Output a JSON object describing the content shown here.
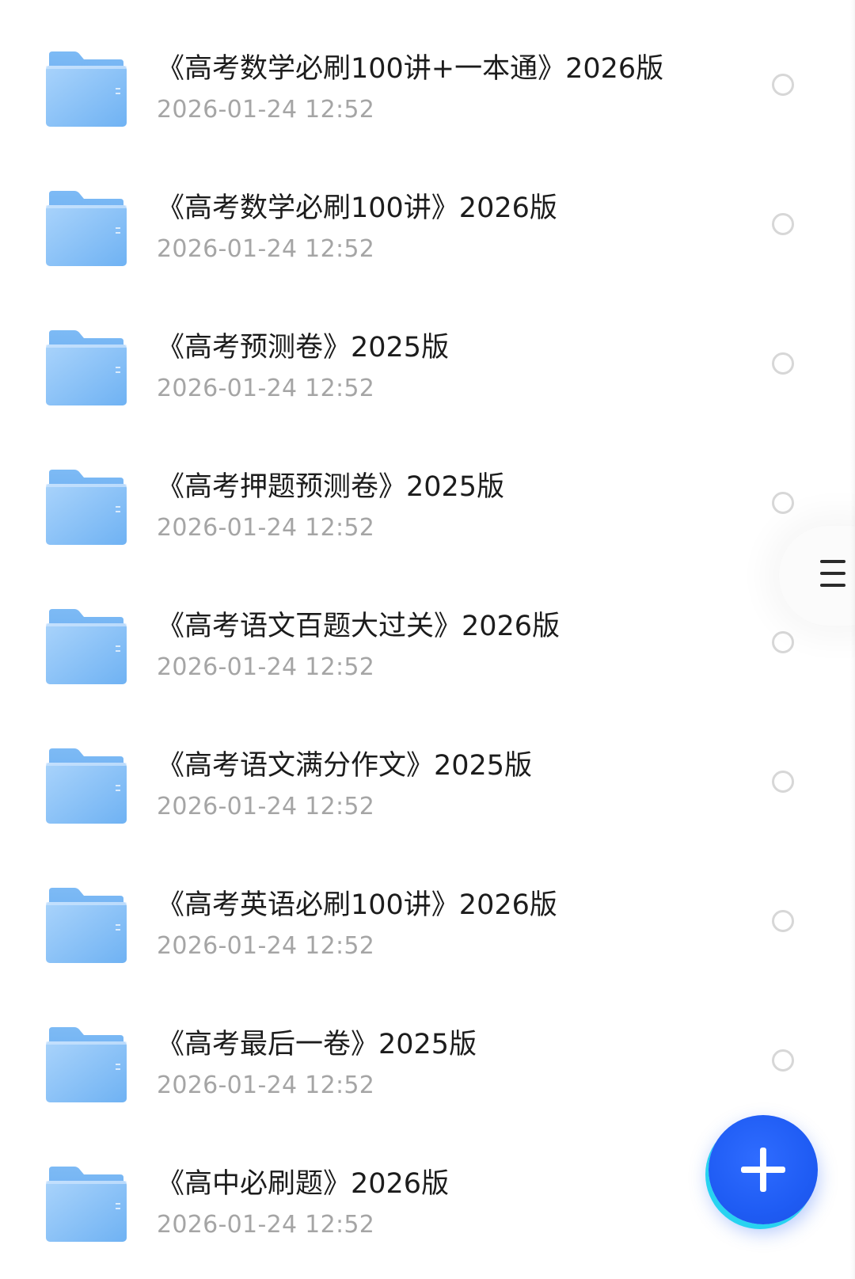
{
  "files": [
    {
      "name": "《高考数学必刷100讲+一本通》2026版",
      "modified": "2026-01-24 12:52",
      "icon": "folder-icon",
      "selected": false
    },
    {
      "name": "《高考数学必刷100讲》2026版",
      "modified": "2026-01-24 12:52",
      "icon": "folder-icon",
      "selected": false
    },
    {
      "name": "《高考预测卷》2025版",
      "modified": "2026-01-24 12:52",
      "icon": "folder-icon",
      "selected": false
    },
    {
      "name": "《高考押题预测卷》2025版",
      "modified": "2026-01-24 12:52",
      "icon": "folder-icon",
      "selected": false
    },
    {
      "name": "《高考语文百题大过关》2026版",
      "modified": "2026-01-24 12:52",
      "icon": "folder-icon",
      "selected": false
    },
    {
      "name": "《高考语文满分作文》2025版",
      "modified": "2026-01-24 12:52",
      "icon": "folder-icon",
      "selected": false
    },
    {
      "name": "《高考英语必刷100讲》2026版",
      "modified": "2026-01-24 12:52",
      "icon": "folder-icon",
      "selected": false
    },
    {
      "name": "《高考最后一卷》2025版",
      "modified": "2026-01-24 12:52",
      "icon": "folder-icon",
      "selected": false
    },
    {
      "name": "《高中必刷题》2026版",
      "modified": "2026-01-24 12:52",
      "icon": "folder-icon",
      "selected": false
    }
  ],
  "side_handle": {
    "icon": "menu-lines-icon"
  },
  "fab": {
    "icon": "plus-icon",
    "color": "#1f5cf4"
  },
  "colors": {
    "folder_light": "#a9d3fb",
    "folder_dark": "#6fb2f3",
    "title_text": "#1c1c1c",
    "date_text": "#a5a5a5",
    "radio_border": "#d7d7d7"
  }
}
